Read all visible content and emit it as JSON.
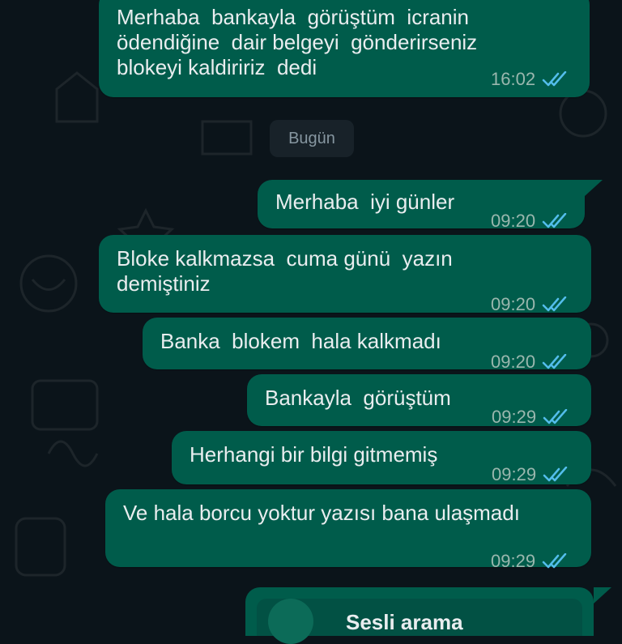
{
  "messages": [
    {
      "direction": "received",
      "text": "Merhaba  bankayla  görüştüm  icranin\nödendiğine  dair belgeyi  gönderirseniz\nblokeyi kaldiririz  dedi",
      "time": "16:02"
    },
    {
      "direction": "sent",
      "text": "Merhaba  iyi günler",
      "time": "09:20"
    },
    {
      "direction": "received",
      "text": "Bloke kalkmazsa  cuma günü  yazın\ndemiştiniz",
      "time": "09:20"
    },
    {
      "direction": "sent",
      "text": "Banka  blokem  hala kalkmadı",
      "time": "09:20"
    },
    {
      "direction": "sent",
      "text": "Bankayla  görüştüm",
      "time": "09:29"
    },
    {
      "direction": "sent",
      "text": "Herhangi bir bilgi gitmemiş",
      "time": "09:29"
    },
    {
      "direction": "received",
      "text": "Ve hala borcu yoktur yazısı bana ulaşmadı",
      "time": "09:29"
    }
  ],
  "date_divider": "Bugün",
  "call_card": {
    "title": "Sesli arama",
    "icon": "phone-icon"
  },
  "colors": {
    "background": "#0b141a",
    "bubble": "#005c4b",
    "date_chip": "#182229",
    "read_ticks": "#53bdeb"
  }
}
